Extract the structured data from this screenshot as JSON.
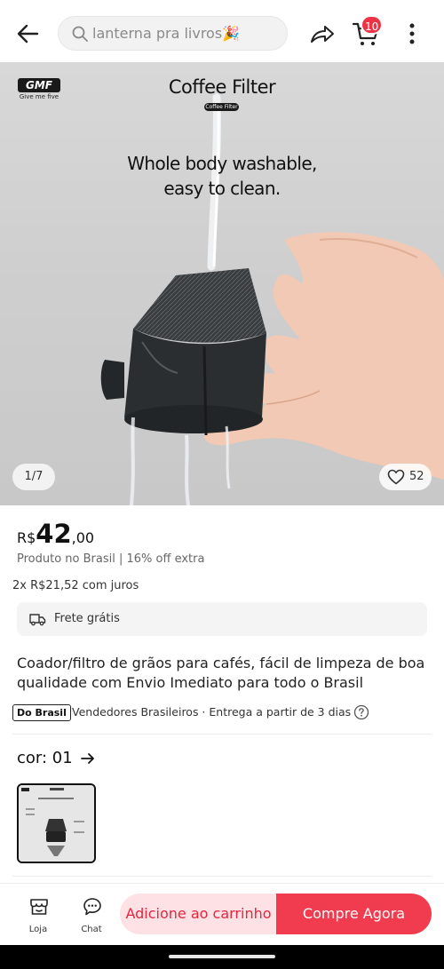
{
  "header": {
    "search_placeholder": "lanterna pra livros🎉",
    "cart_count": "10"
  },
  "hero": {
    "brand": "GMF",
    "brand_tagline": "Give me five",
    "title": "Coffee Filter",
    "chip": "Coffee Filter",
    "headline_line1": "Whole body washable,",
    "headline_line2": "easy to clean.",
    "page_indicator": "1/7",
    "favorites_count": "52"
  },
  "product": {
    "currency": "R$",
    "price_int": "42",
    "price_dec": ",00",
    "price_note": "Produto no Brasil | 16% off extra",
    "installments": "2x R$21,52 com juros",
    "shipping": "Frete grátis",
    "title": "Coador/filtro de grãos para cafés, fácil de limpeza de boa qualidade com Envio Imediato para todo o Brasil",
    "seller_badge": "Do Brasil",
    "seller_text": "Vendedores Brasileiros · Entrega a partir de 3 dias",
    "color_label": "cor: 01"
  },
  "bottom": {
    "store_label": "Loja",
    "chat_label": "Chat",
    "add_to_cart": "Adicione ao carrinho",
    "buy_now": "Compre Agora"
  },
  "colors": {
    "accent": "#f03c4e",
    "accent_soft": "#fde1e4",
    "badge": "#ee3344"
  },
  "icons": [
    "arrow-left-icon",
    "search-icon",
    "share-icon",
    "cart-icon",
    "more-vertical-icon",
    "heart-icon",
    "truck-icon",
    "help-circle-icon",
    "arrow-right-icon",
    "store-icon",
    "chat-icon"
  ]
}
